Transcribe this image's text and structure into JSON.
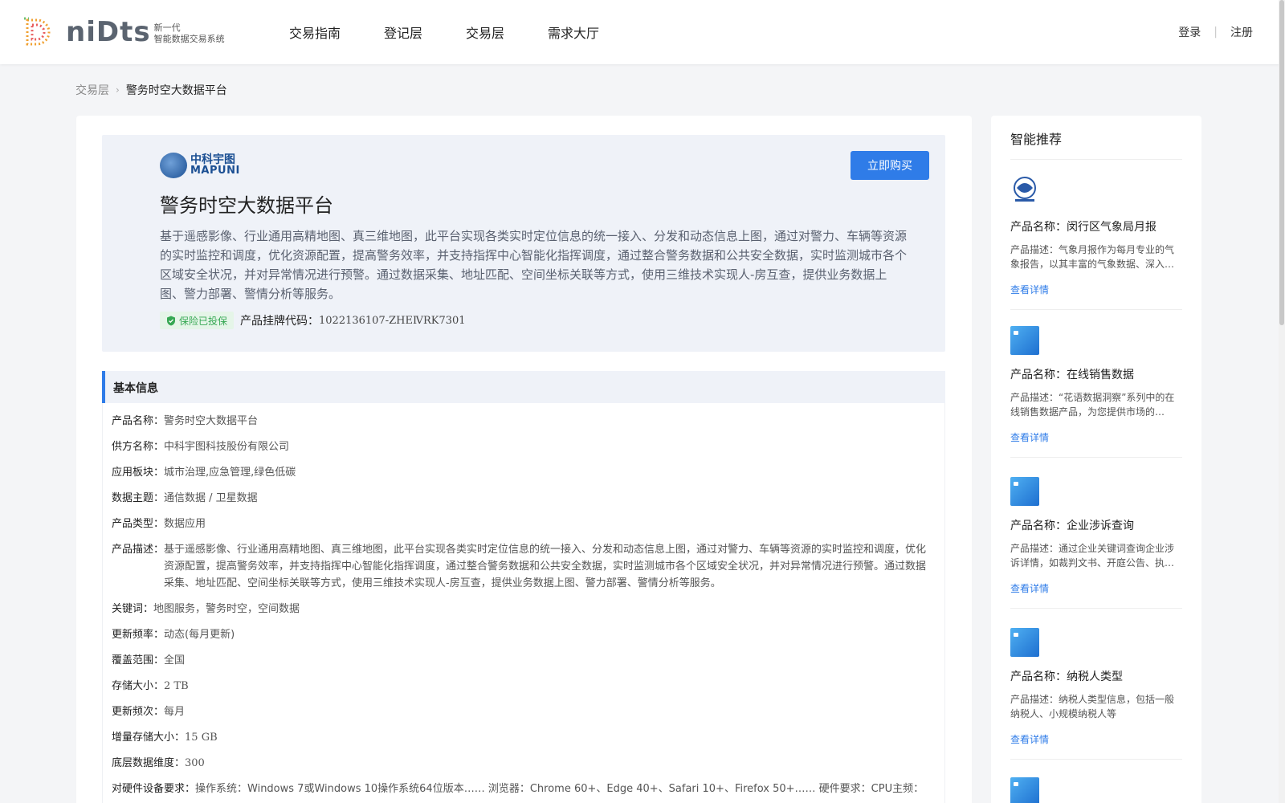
{
  "header": {
    "logo_word": "niDts",
    "logo_sub1": "新一代",
    "logo_sub2": "智能数据交易系统",
    "nav": [
      "交易指南",
      "登记层",
      "交易层",
      "需求大厅"
    ],
    "login": "登录",
    "register": "注册"
  },
  "breadcrumb": {
    "parent": "交易层",
    "arrow": "›",
    "current": "警务时空大数据平台"
  },
  "hero": {
    "brand_cn": "中科宇图",
    "brand_en": "MAPUNI",
    "buy_label": "立即购买",
    "title": "警务时空大数据平台",
    "description": "基于遥感影像、行业通用高精地图、真三维地图，此平台实现各类实时定位信息的统一接入、分发和动态信息上图，通过对警力、车辆等资源的实时监控和调度，优化资源配置，提高警务效率，并支持指挥中心智能化指挥调度，通过整合警务数据和公共安全数据，实时监测城市各个区域安全状况，并对异常情况进行预警。通过数据采集、地址匹配、空间坐标关联等方式，使用三维技术实现人-房互查，提供业务数据上图、警力部署、警情分析等服务。",
    "badge": "保险已投保",
    "code_label": "产品挂牌代码：",
    "code_value": "1022136107-ZHEⅣRK7301"
  },
  "basic": {
    "title": "基本信息",
    "rows": [
      {
        "k": "产品名称：",
        "v": "警务时空大数据平台"
      },
      {
        "k": "供方名称：",
        "v": "中科宇图科技股份有限公司"
      },
      {
        "k": "应用板块：",
        "v": "城市治理,应急管理,绿色低碳"
      },
      {
        "k": "数据主题：",
        "v": "通信数据 / 卫星数据"
      },
      {
        "k": "产品类型：",
        "v": "数据应用"
      },
      {
        "k": "产品描述：",
        "v": "基于遥感影像、行业通用高精地图、真三维地图，此平台实现各类实时定位信息的统一接入、分发和动态信息上图，通过对警力、车辆等资源的实时监控和调度，优化资源配置，提高警务效率，并支持指挥中心智能化指挥调度，通过整合警务数据和公共安全数据，实时监测城市各个区域安全状况，并对异常情况进行预警。通过数据采集、地址匹配、空间坐标关联等方式，使用三维技术实现人-房互查，提供业务数据上图、警力部署、警情分析等服务。"
      },
      {
        "k": "关键词：",
        "v": "地图服务，警务时空，空间数据"
      },
      {
        "k": "更新频率：",
        "v": "动态(每月更新)"
      },
      {
        "k": "覆盖范围：",
        "v": "全国"
      },
      {
        "k": "存储大小：",
        "v": "2 TB"
      },
      {
        "k": "更新频次：",
        "v": "每月"
      },
      {
        "k": "增量存储大小：",
        "v": "15 GB"
      },
      {
        "k": "底层数据维度：",
        "v": "300"
      },
      {
        "k": "对硬件设备要求：",
        "v": "操作系统：Windows 7或Windows 10操作系统64位版本…… 浏览器：Chrome 60+、Edge 40+、Safari 10+、Firefox 50+…… 硬件要求：CPU主频："
      }
    ]
  },
  "sidebar": {
    "title": "智能推荐",
    "link_label": "查看详情",
    "items": [
      {
        "name": "产品名称：闵行区气象局月报",
        "desc": "产品描述：气象月报作为每月专业的气象报告，以其丰富的气象数据、深入…"
      },
      {
        "name": "产品名称：在线销售数据",
        "desc": "产品描述：“花语数据洞察”系列中的在线销售数据产品，为您提供市场的…"
      },
      {
        "name": "产品名称：企业涉诉查询",
        "desc": "产品描述：通过企业关键词查询企业涉诉详情，如裁判文书、开庭公告、执…"
      },
      {
        "name": "产品名称：纳税人类型",
        "desc": "产品描述：纳税人类型信息，包括一般纳税人、小规模纳税人等"
      }
    ]
  }
}
